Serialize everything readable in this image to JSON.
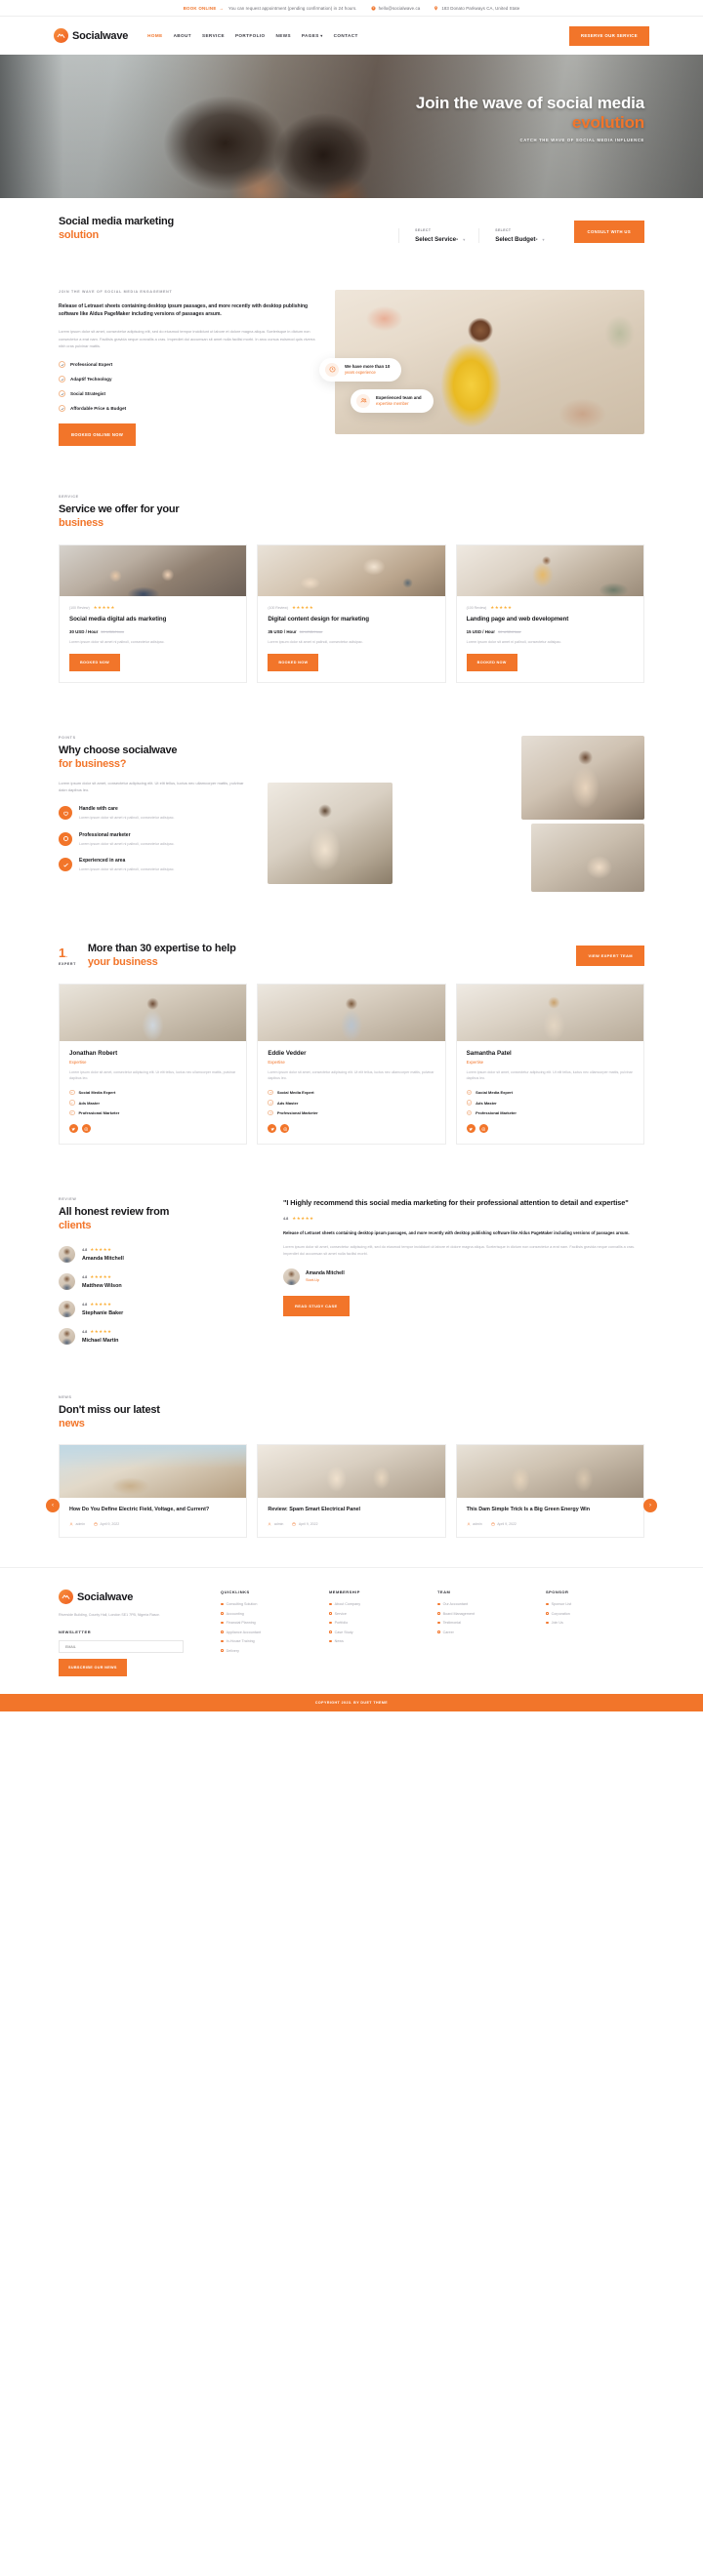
{
  "topbar": {
    "book_label": "BOOK ONLINE",
    "note": "You can request appointment (pending confirmation) in 24 hours.",
    "email": "hello@socialwave.ca",
    "address": "183 Donato Parkways CA, United State"
  },
  "header": {
    "brand": "Socialwave",
    "nav": [
      {
        "label": "HOME",
        "active": true
      },
      {
        "label": "ABOUT",
        "active": false
      },
      {
        "label": "SERVICE",
        "active": false
      },
      {
        "label": "PORTFOLIO",
        "active": false
      },
      {
        "label": "NEWS",
        "active": false
      },
      {
        "label": "PAGES",
        "active": false,
        "caret": true
      },
      {
        "label": "CONTACT",
        "active": false
      }
    ],
    "cta": "RESERVE OUR SERVICE"
  },
  "hero": {
    "title_line1": "Join the wave of social media",
    "title_accent": "evolution",
    "subtitle": "CATCH THE WAVE OF SOCIAL MEDIA INFLUENCE"
  },
  "consult": {
    "title_line1": "Social media marketing",
    "title_accent": "solution",
    "selects": [
      {
        "label": "SELECT",
        "value": "Select Service-"
      },
      {
        "label": "SELECT",
        "value": "Select Budget-"
      }
    ],
    "cta": "CONSULT WITH US"
  },
  "about": {
    "eyebrow": "JOIN THE WAVE OF SOCIAL MEDIA ENGAGEMENT",
    "lead": "Release of Letraset sheets containing desktop ipsum passages, and more recently with desktop publishing software like Aldus PageMaker including versions of passages arsum.",
    "body": "Lorem ipsum dolor sit amet, consectetur adipiscing elit, sed do eiusmod tempor incididunt ut labore et dolore magna aliqua. Scelerisque in dictum non consectetur a erat nam. Facilisis gravida neque convallis a cras. Imperdiet dui accumsan sit amet nulla facilisi morbi. In arcu cursus euismod quis viverra nibh cras pulvinar mattis.",
    "checks": [
      "Professional Expert",
      "Adaptif Technology",
      "Social Strategist",
      "Affordable Price & Budget"
    ],
    "cta": "BOOKED ONLINE NOW",
    "badges": [
      {
        "title": "We have more than 10",
        "sub": "years experience",
        "icon": "clock-icon"
      },
      {
        "title": "Experienced team and",
        "sub": "expertise member",
        "icon": "team-icon"
      }
    ]
  },
  "service": {
    "eyebrow": "SERVICE",
    "title_line1": "Service we offer for your",
    "title_accent": "business",
    "cards": [
      {
        "reviews": "(100 Review)",
        "stars": "★★★★★",
        "title": "Social media digital ads marketing",
        "price": "30 USD / Hour",
        "old_price": "50 USD/Hour",
        "desc": "Lorem ipsum dolor sit amet ni palinoli, consectetur adisipac.",
        "cta": "BOOKED NOW"
      },
      {
        "reviews": "(100 Review)",
        "stars": "★★★★★",
        "title": "Digital content design for marketing",
        "price": "35 USD / Hour",
        "old_price": "50 USD/Hour",
        "desc": "Lorem ipsum dolor sit amet ni palinoli, consectetur adisipac.",
        "cta": "BOOKED NOW"
      },
      {
        "reviews": "(100 Review)",
        "stars": "★★★★★",
        "title": "Landing page and web development",
        "price": "15 USD / Hour",
        "old_price": "30 USD/Hour",
        "desc": "Lorem ipsum dolor sit amet ni palinoli, consectetur adisipac.",
        "cta": "BOOKED NOW"
      }
    ]
  },
  "why": {
    "eyebrow": "POINTS",
    "title_line1": "Why choose socialwave",
    "title_accent": "for business?",
    "body": "Lorem ipsum dolor sit amet, consectetur adipiscing elit. Ut elit tellus, luctus nec ullamcorper mattis, pulvinar dakn dapibus leo.",
    "features": [
      {
        "icon": "heart-icon",
        "title": "Handle with care",
        "desc": "Lorem ipsum dolor sit amet ni palinoli, consectetur adisipac."
      },
      {
        "icon": "circle-icon",
        "title": "Professional marketer",
        "desc": "Lorem ipsum dolor sit amet ni palinoli, consectetur adisipac."
      },
      {
        "icon": "check-icon",
        "title": "Experienced in area",
        "desc": "Lorem ipsum dolor sit amet ni palinoli, consectetur adisipac."
      }
    ]
  },
  "team": {
    "number": "1",
    "number_label": "EXPERT",
    "title_line1": "More than 30 expertise to help",
    "title_accent": "your business",
    "cta": "VIEW EXPERT TEAM",
    "members": [
      {
        "name": "Jonathan Robert",
        "role": "Expertise",
        "desc": "Lorem ipsum dolor sit amet, consectetur adipiscing elit. Ut elit tellus, luctus nec ullamcorper mattis, pulvinar dapibus leo.",
        "skills": [
          "Social Media Expert",
          "Ads Master",
          "Professional Marketer"
        ]
      },
      {
        "name": "Eddie Vedder",
        "role": "Expertise",
        "desc": "Lorem ipsum dolor sit amet, consectetur adipiscing elit. Ut elit tellus, luctus nec ullamcorper mattis, pulvinar dapibus leo.",
        "skills": [
          "Social Media Expert",
          "Ads Master",
          "Professional Marketer"
        ]
      },
      {
        "name": "Samantha Patel",
        "role": "Expertise",
        "desc": "Lorem ipsum dolor sit amet, consectetur adipiscing elit. Ut elit tellus, luctus nec ullamcorper mattis, pulvinar dapibus leo.",
        "skills": [
          "Social Media Expert",
          "Ads Master",
          "Professional Marketer"
        ]
      }
    ]
  },
  "reviews": {
    "eyebrow": "REVIEW",
    "title_line1": "All honest review from",
    "title_accent": "clients",
    "list": [
      {
        "score": "4.8",
        "stars": "★★★★★",
        "name": "Amanda Mitchell"
      },
      {
        "score": "4.8",
        "stars": "★★★★★",
        "name": "Matthew Wilson"
      },
      {
        "score": "4.8",
        "stars": "★★★★★",
        "name": "Stephanie Baker"
      },
      {
        "score": "4.8",
        "stars": "★★★★★",
        "name": "Michael Martin"
      }
    ],
    "featured": {
      "quote": "\"I Highly recommend this social media marketing for their professional attention to detail and expertise\"",
      "score": "4.8",
      "stars": "★★★★★",
      "lead": "Release of Letraset sheets containing desktop ipsum passages, and more recently with desktop publishing software like Aldus PageMaker including versions of passages arsum.",
      "body": "Lorem ipsum dolor sit amet, consectetur adipiscing elit, sed do eiusmod tempor incididunt ut labore et dolore magna aliqua. Scelerisque in dictum non consectetur a erat nam. Facilisis gravida neque convallis a cras. Imperdiet dui accumsan sit amet nulla facilisi morbi.",
      "author_name": "Amanda Mitchell",
      "author_role": "Start-Up",
      "cta": "READ STUDY CASE"
    }
  },
  "news": {
    "eyebrow": "NEWS",
    "title_line1": "Don't miss our latest",
    "title_accent": "news",
    "posts": [
      {
        "title": "How Do You Define Electric Field, Voltage, and Current?",
        "author": "admin",
        "date": "April 9, 2022"
      },
      {
        "title": "Review: Spam Smart Electrical Panel",
        "author": "admin",
        "date": "April 9, 2022"
      },
      {
        "title": "This Dam Simple Trick Is a Big Green Energy Win",
        "author": "admin",
        "date": "April 9, 2022"
      }
    ]
  },
  "footer": {
    "brand": "Socialwave",
    "address": "Riverside Building, County Hall, London SE1 7PB, Nigeria Rasor.",
    "newsletter_title": "NEWSLETTER",
    "email_placeholder": "EMAIL",
    "subscribe_cta": "SUBSCRIBE OUR NEWS",
    "columns": [
      {
        "title": "QUICKLINKS",
        "items": [
          "Consulting Solution",
          "Accounting",
          "Financial Planning",
          "Appliance Accountant",
          "In-House Training",
          "Delivery"
        ]
      },
      {
        "title": "MEMBERSHIP",
        "items": [
          "About Company",
          "Service",
          "Portfolio",
          "Case Study",
          "News"
        ]
      },
      {
        "title": "TEAM",
        "items": [
          "Our Accountant",
          "Board Management",
          "Testimonial",
          "Career"
        ]
      },
      {
        "title": "SPONSOR",
        "items": [
          "Sponsor List",
          "Corporation",
          "Join Us"
        ]
      }
    ],
    "copyright": "COPYRIGHT 2023. BY DUET THEME"
  }
}
